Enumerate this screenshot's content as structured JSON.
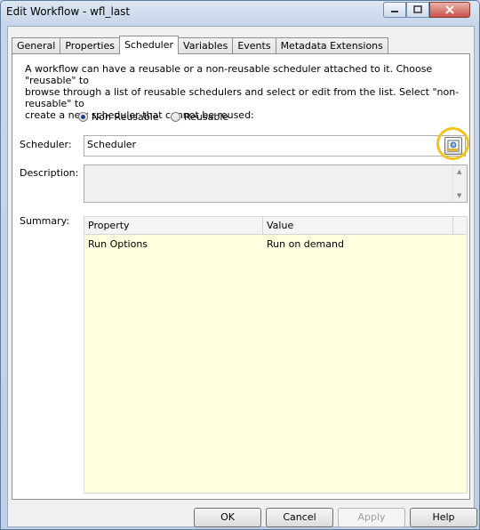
{
  "window": {
    "title": "Edit Workflow - wfl_last"
  },
  "tabs": [
    "General",
    "Properties",
    "Scheduler",
    "Variables",
    "Events",
    "Metadata Extensions"
  ],
  "active_tab": "Scheduler",
  "scheduler_tab": {
    "intro": "A workflow can have a reusable or a non-reusable scheduler attached to it.  Choose \"reusable\" to\nbrowse through a list of reusable schedulers and select or edit from the list.  Select \"non-reusable\" to\ncreate a new scheduler that cannot be reused:",
    "radio_non_reusable": "Non Reusable",
    "radio_reusable": "Reusable",
    "selected_option": "Non Reusable",
    "scheduler_label": "Scheduler:",
    "scheduler_value": "Scheduler",
    "description_label": "Description:",
    "description_value": "",
    "summary_label": "Summary:",
    "summary_columns": [
      "Property",
      "Value"
    ],
    "summary_rows": [
      {
        "property": "Run Options",
        "value": "Run on demand"
      }
    ]
  },
  "buttons": {
    "ok": "OK",
    "cancel": "Cancel",
    "apply": "Apply",
    "help": "Help"
  },
  "colors": {
    "summary_bg": "#ffffe0",
    "highlight": "#f2c21d"
  }
}
